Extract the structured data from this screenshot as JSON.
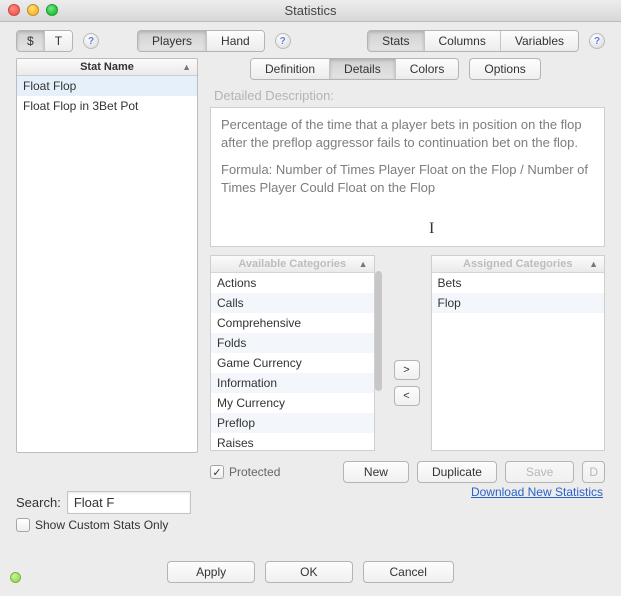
{
  "window": {
    "title": "Statistics"
  },
  "toolbar": {
    "mode": {
      "dollar": "$",
      "t": "T"
    },
    "group1": {
      "players": "Players",
      "hand": "Hand"
    },
    "group2": {
      "stats": "Stats",
      "columns": "Columns",
      "variables": "Variables"
    }
  },
  "statlist": {
    "header": "Stat Name",
    "items": [
      "Float Flop",
      "Float Flop in 3Bet Pot"
    ],
    "selected_index": 0
  },
  "tabs": {
    "definition": "Definition",
    "details": "Details",
    "colors": "Colors",
    "options": "Options"
  },
  "detail": {
    "label": "Detailed Description:",
    "text_p1": "Percentage of the time that a player bets in position on the flop after the preflop aggressor fails to continuation bet on the flop.",
    "text_p2": "Formula: Number of Times Player Float on the Flop / Number of Times Player Could Float on the Flop"
  },
  "categories": {
    "available_header": "Available Categories",
    "assigned_header": "Assigned Categories",
    "available": [
      "Actions",
      "Calls",
      "Comprehensive",
      "Folds",
      "Game Currency",
      "Information",
      "My Currency",
      "Preflop",
      "Raises"
    ],
    "assigned": [
      "Bets",
      "Flop"
    ],
    "move_right": ">",
    "move_left": "<"
  },
  "bottom": {
    "protected": "Protected",
    "new": "New",
    "duplicate": "Duplicate",
    "save": "Save",
    "d": "D"
  },
  "search": {
    "label": "Search:",
    "value": "Float F",
    "show_custom": "Show Custom Stats Only"
  },
  "link": {
    "download": "Download New Statistics"
  },
  "footer": {
    "apply": "Apply",
    "ok": "OK",
    "cancel": "Cancel"
  }
}
